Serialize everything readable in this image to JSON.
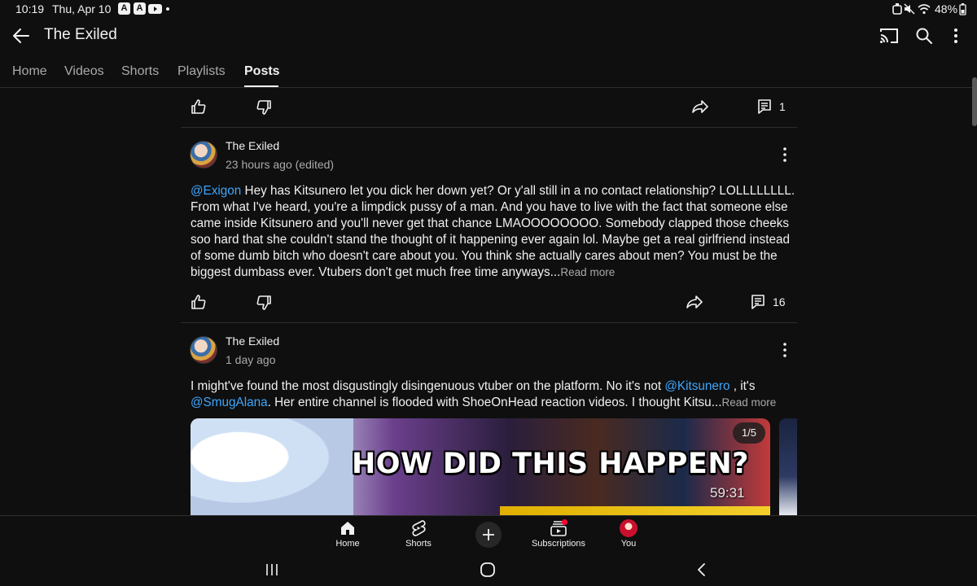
{
  "status_bar": {
    "time": "10:19",
    "date": "Thu, Apr 10",
    "battery": "48%",
    "notification_icons": [
      "a-app-icon",
      "a-app-icon",
      "youtube-icon"
    ]
  },
  "header": {
    "title": "The Exiled"
  },
  "tabs": [
    {
      "label": "Home"
    },
    {
      "label": "Videos"
    },
    {
      "label": "Shorts"
    },
    {
      "label": "Playlists"
    },
    {
      "label": "Posts",
      "active": true
    }
  ],
  "posts": [
    {
      "comment_count": "1"
    },
    {
      "author": "The Exiled",
      "time": "23 hours ago (edited)",
      "mention": "@Exigon",
      "text": " Hey has Kitsunero let you dick her down yet? Or y'all still in a no contact relationship? LOLLLLLLLL. From what I've heard, you're a limpdick pussy of a man. And you have to live with the fact that someone else came inside Kitsunero and you'll never get that chance LMAOOOOOOOO. Somebody clapped those cheeks soo hard that she couldn't stand the thought of it happening ever again lol. Maybe get a real girlfriend instead of some dumb bitch who doesn't care about you. You think she actually cares about men? You must be the biggest dumbass ever. Vtubers don't get much free time anyways...",
      "read_more": "Read more",
      "comment_count": "16"
    },
    {
      "author": "The Exiled",
      "time": "1 day ago",
      "text_a": "I might've found the most disgustingly disingenuous vtuber on the platform. No it's not ",
      "mention_a": "@Kitsunero",
      "text_b": " , it's ",
      "mention_b": "@SmugAlana",
      "text_c": ". Her entire channel is flooded with ShoeOnHead reaction videos. I thought Kitsu...",
      "read_more": "Read more",
      "image": {
        "headline": "HOW DID THIS HAPPEN?",
        "duration": "59:31",
        "page_indicator": "1/5"
      }
    }
  ],
  "bottom_nav": [
    {
      "label": "Home",
      "icon": "home-icon"
    },
    {
      "label": "Shorts",
      "icon": "shorts-icon"
    },
    {
      "label": "",
      "icon": "create-plus-icon"
    },
    {
      "label": "Subscriptions",
      "icon": "subscriptions-icon"
    },
    {
      "label": "You",
      "icon": "you-avatar"
    }
  ],
  "colors": {
    "background": "#0f0f0f",
    "text": "#f1f1f1",
    "secondary_text": "#aaaaaa",
    "link": "#3ea6ff",
    "divider": "#2e2e2e"
  }
}
